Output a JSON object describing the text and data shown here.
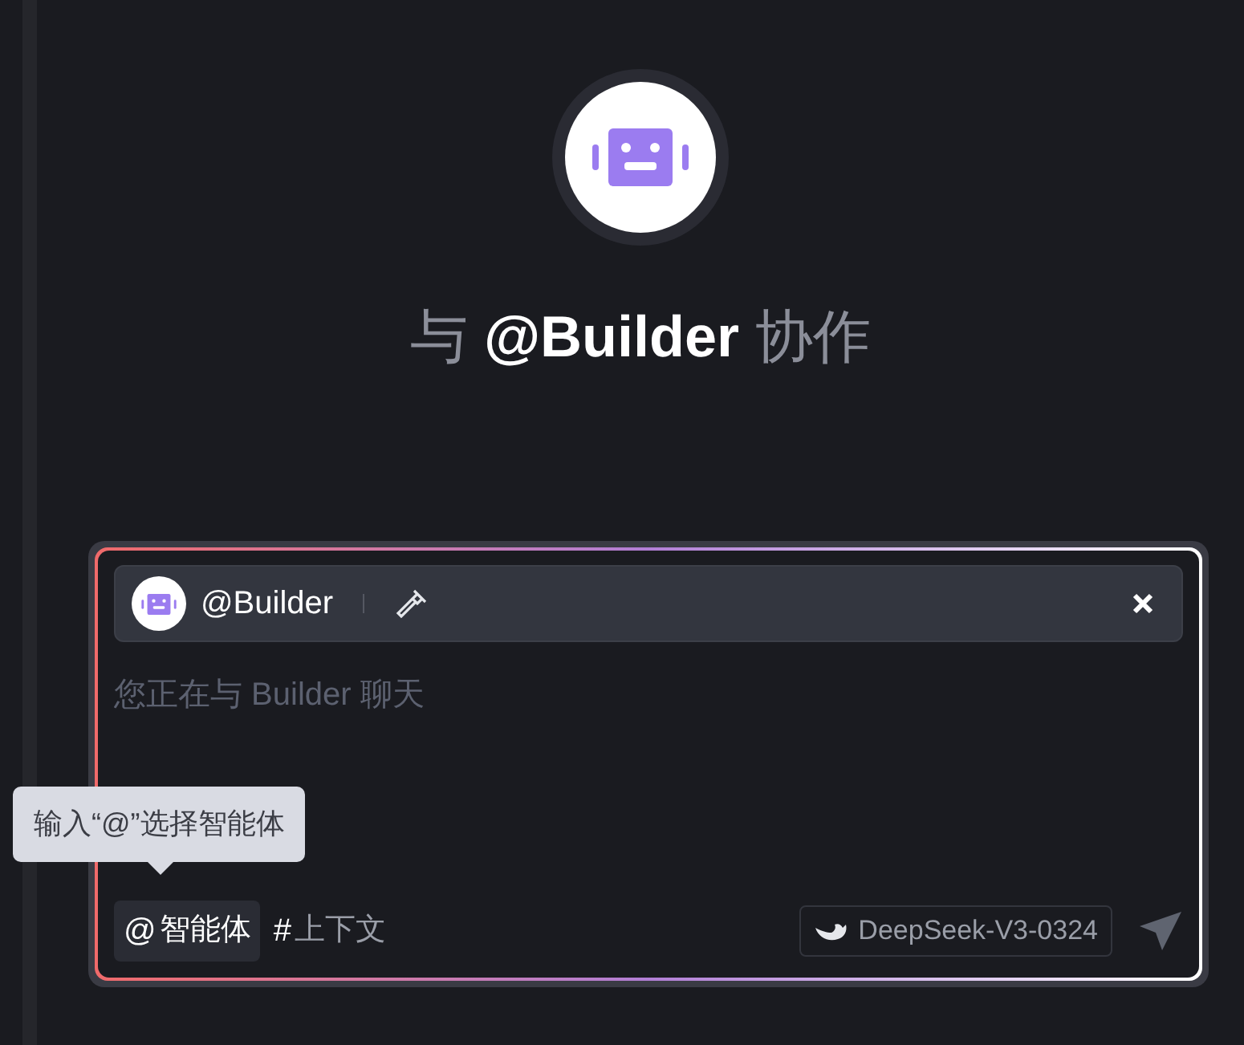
{
  "heading": "与 **@Builder** 协作",
  "agent_chip": {
    "name": "@Builder"
  },
  "input": {
    "placeholder": "您正在与 Builder 聊天"
  },
  "tooltip": "输入“@”选择智能体",
  "tools": [
    {
      "symbol": "@",
      "label": "智能体",
      "selected": true
    },
    {
      "symbol": "#",
      "label": "上下文",
      "selected": false
    }
  ],
  "model": "DeepSeek-V3-0324"
}
